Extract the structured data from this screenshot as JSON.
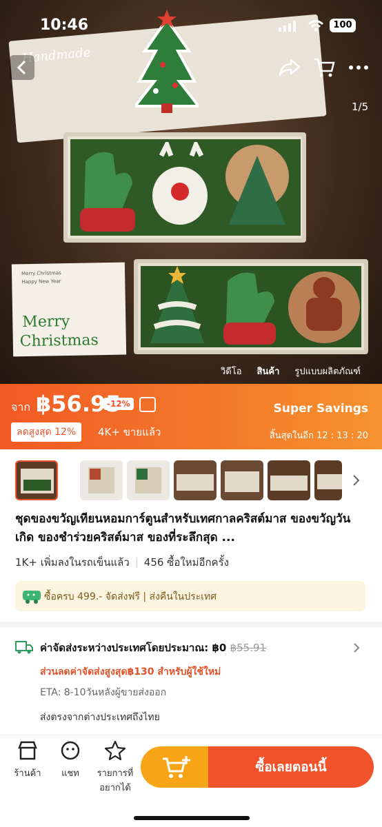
{
  "status_bar": {
    "time": "10:46",
    "battery": "100"
  },
  "hero": {
    "image_counter": "1/5",
    "media_tabs": [
      "วิดีโอ",
      "สินค้า",
      "รูปแบบผลิตภัณฑ์"
    ],
    "box_text": "Handmade",
    "card_line1": "Merry Christmas",
    "card_line2": "Happy New Year",
    "card_merry": "Merry",
    "card_christmas": "Christmas"
  },
  "promo": {
    "from_label": "จาก",
    "price": "฿56.95",
    "discount_badge": "-12%",
    "max_discount": "ลดสูงสุด 12%",
    "sold": "4K+ ขายแล้ว",
    "super_savings": "Super Savings",
    "ends_in": "สิ้นสุดในอีก 12 : 13 : 20"
  },
  "product": {
    "title": "ชุดของขวัญเทียนหอมการ์ตูนสำหรับเทศกาลคริสต์มาส ของขวัญวันเกิด ของชำร่วยคริสต์มาส ของที่ระลึกสุด ...",
    "added_to_cart": "1K+ เพิ่มลงในรถเข็นแล้ว",
    "repurchase": "456 ซื้อใหม่อีกครั้ง"
  },
  "ship_banner": {
    "text": "ซื้อครบ 499.- จัดส่งฟรี  |  ส่งคืนในประเทศ"
  },
  "shipping": {
    "label": "ค่าจัดส่งระหว่างประเทศโดยประมาณ: ฿0",
    "old_price": "฿55.91",
    "promo": "ส่วนลดค่าจัดส่งสูงสุด฿130 สำหรับผู้ใช้ใหม่",
    "eta": "ETA: 8-10วันหลังผู้ขายส่งออก",
    "origin": "ส่งตรงจากต่างประเทศถึงไทย"
  },
  "bottom": {
    "shop": "ร้านค้า",
    "chat": "แชท",
    "wishlist_line1": "รายการที่",
    "wishlist_line2": "อยากได้",
    "buy_now": "ซื้อเลยตอนนี้"
  },
  "colors": {
    "accent": "#f0522a",
    "cart": "#f8a417",
    "promo_start": "#f25a24",
    "promo_end": "#f6932f"
  }
}
